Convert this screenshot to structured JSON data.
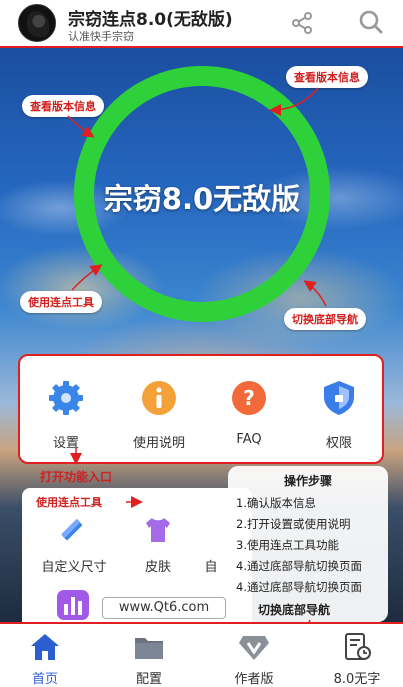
{
  "header": {
    "title": "宗窃连点8.0(无敌版)",
    "subtitle": "认准快手宗窃"
  },
  "hero": {
    "ring_text": "宗窃8.0无敌版"
  },
  "annotations": {
    "version_info_right": "查看版本信息",
    "version_info_left": "查看版本信息",
    "use_tool_left": "使用连点工具",
    "switch_nav_right": "切换底部导航",
    "open_func": "打开功能入口",
    "use_tool_card": "使用连点工具",
    "switch_nav_bottom": "切换底部导航"
  },
  "functions": [
    {
      "label": "设置",
      "icon": "gear-icon"
    },
    {
      "label": "使用说明",
      "icon": "info-icon"
    },
    {
      "label": "FAQ",
      "icon": "question-icon"
    },
    {
      "label": "权限",
      "icon": "shield-icon"
    }
  ],
  "tools": [
    {
      "label": "自定义尺寸",
      "icon": "ruler-pencil-icon"
    },
    {
      "label": "皮肤",
      "icon": "shirt-icon"
    },
    {
      "label": "自",
      "icon": "partial-icon"
    }
  ],
  "site": "www.Qt6.com",
  "steps": {
    "title": "操作步骤",
    "items": [
      "1.确认版本信息",
      "2.打开设置或使用说明",
      "3.使用连点工具功能",
      "4.通过底部导航切换页面",
      "4.通过底部导航切换页面"
    ]
  },
  "nav": [
    {
      "label": "首页",
      "icon": "home-icon",
      "active": true
    },
    {
      "label": "配置",
      "icon": "folder-icon",
      "active": false
    },
    {
      "label": "作者版",
      "icon": "vip-diamond-icon",
      "active": false
    },
    {
      "label": "8.0无字",
      "icon": "notepad-clock-icon",
      "active": false
    }
  ],
  "colors": {
    "accent_red": "#e02020",
    "ring_green": "#2fd13a",
    "nav_active": "#2b5fd0"
  }
}
